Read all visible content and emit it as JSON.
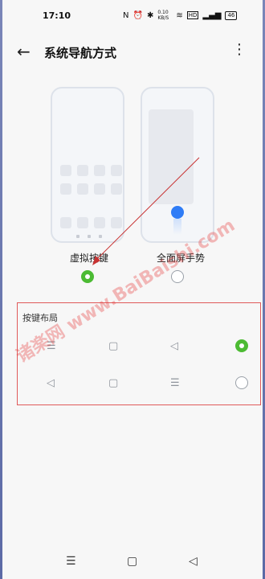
{
  "status_bar": {
    "time": "17:10",
    "speed": "0.10 KB/S",
    "battery": "46"
  },
  "header": {
    "title": "系统导航方式"
  },
  "options": [
    {
      "label": "虚拟按键",
      "selected": true
    },
    {
      "label": "全面屏手势",
      "selected": false
    }
  ],
  "layout": {
    "title": "按键布局",
    "rows": [
      {
        "symbols": [
          "☰",
          "▢",
          "◁"
        ],
        "selected": true
      },
      {
        "symbols": [
          "◁",
          "▢",
          "☰"
        ],
        "selected": false
      }
    ]
  },
  "nav_bar": {
    "menu": "☰",
    "home": "▢",
    "back": "◁"
  },
  "watermark": "诸楽网 www.BaiBaishi.com",
  "colors": {
    "accent": "#4cbb33",
    "annotation": "#e05a5a",
    "blue": "#2f7cf6"
  }
}
